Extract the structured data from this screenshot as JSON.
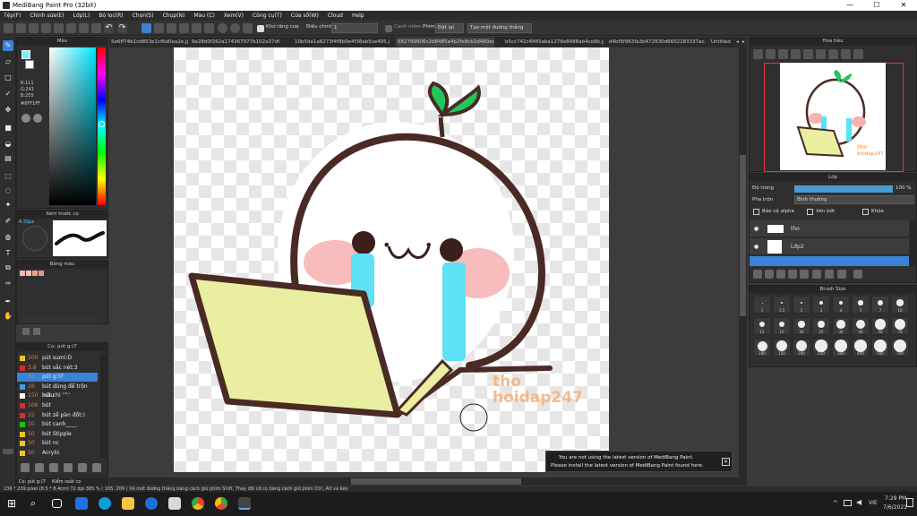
{
  "window": {
    "title": "MediBang Paint Pro (32bit)",
    "minimize": "—",
    "maximize": "☐",
    "close": "✕"
  },
  "menu": [
    "Tệp(F)",
    "Chỉnh sửa(E)",
    "Lớp(L)",
    "Bộ lọc(R)",
    "Chọn(S)",
    "Chụp(N)",
    "Màu (C)",
    "Xem(V)",
    "Công cụ(T)",
    "Cửa sổ(W)",
    "Cloud",
    "Help"
  ],
  "toolbar": {
    "antialias": "Khử răng cưa",
    "correction_label": "Điều chỉnh",
    "correction_value": "1",
    "edge_snap": "Canh mềm",
    "snap_label": "Phím",
    "snap_off": "Đặt lại",
    "create_snap": "Tạo một đường thẳng"
  },
  "doc_tabs": [
    "5e6ff74b1cd853e1cf6d0ea2e.jpg",
    "9e28d0f262a174367977b102a37d642ef.jpg",
    "10b5da1a6273f4f8b9e4f38ab5ce495.jpg",
    "582799906c2d8485a4b2fe8cb2d489ed.jpg",
    "b5cc742c4865aba1278e8488ab4ce8b.jpg",
    "d4bf5f963fa3b472830d6602183337ac.jpg",
    "Untitled"
  ],
  "color_panel": {
    "title": "Màu",
    "r": "R:111",
    "g": "G:241",
    "b": "B:255",
    "hex": "#6FF1FF"
  },
  "preview_panel": {
    "title": "Xem trước cọ",
    "size": "4.32px"
  },
  "palette_panel": {
    "title": "Bảng màu",
    "swatches": [
      "#f4b8a8",
      "#f6c0b0",
      "#f0a090"
    ]
  },
  "brush_panel": {
    "title": "Cọ: pút g:)7",
    "brushes": [
      {
        "size": "100",
        "name": "pút sumi:D",
        "color": "#e8c820"
      },
      {
        "size": "3.8",
        "name": "bút sắc nét:3",
        "color": "#d03030"
      },
      {
        "size": "33",
        "name": "pút g:)7",
        "color": "#2a8ae0"
      },
      {
        "size": "26",
        "name": "bút dùng để trộn màu",
        "color": "#3aa0e0"
      },
      {
        "size": "150",
        "name": "bút chì '^'",
        "color": "#ffffff"
      },
      {
        "size": "106",
        "name": "bút",
        "color": "#d03030"
      },
      {
        "size": "15",
        "name": "bút zế pàn đốt:)",
        "color": "#d03030"
      },
      {
        "size": "10",
        "name": "bút canh____",
        "color": "#20c020"
      },
      {
        "size": "50",
        "name": "bút Stipple",
        "color": "#e8c820"
      },
      {
        "size": "50",
        "name": "bút nc",
        "color": "#e8c820"
      },
      {
        "size": "50",
        "name": "Acrylic",
        "color": "#e8c820"
      }
    ],
    "bottom_tabs": [
      "Cọ: pút g:)7",
      "Kiểm soát cọ"
    ]
  },
  "navigator": {
    "title": "Hoa tiêu"
  },
  "layer_panel": {
    "title": "Lớp",
    "opacity_label": "Độ trong",
    "opacity_value": "100 %",
    "opacity_fraction": 1.0,
    "blend_label": "Pha trộn",
    "blend_value": "Bình thường",
    "protect_alpha": "Bảo vệ alpha",
    "clipping": "Xén bớt",
    "lock": "Khóa",
    "layers": [
      {
        "name": "tho"
      },
      {
        "name": "Lớp2"
      }
    ]
  },
  "brush_size_panel": {
    "title": "Brush Size",
    "row1": [
      "1",
      "1.5",
      "2",
      "3",
      "4",
      "5",
      "7",
      "10"
    ],
    "row2": [
      "12",
      "15",
      "20",
      "25",
      "30",
      "40",
      "50",
      "70"
    ],
    "row3": [
      "100",
      "150",
      "200",
      "250",
      "300",
      "400",
      "500",
      "700"
    ]
  },
  "canvas": {
    "watermark_line1": "tho",
    "watermark_line2": "hoidap247"
  },
  "notification": {
    "line1": "You are not using the latest version of MediBang Paint.",
    "line2": "Please install the latest version of MediBang Paint found here."
  },
  "statusbar": "236 * 239 pixel  (8.5 * 8.4cm)  72 dpi  385 %  ( 165, 209 )  Vẽ một đường thẳng bằng cách giữ phím Shift, Thay đổi cỡ cọ bằng cách giữ phím Ctrl, Alt và kéo",
  "taskbar": {
    "lang": "VIE",
    "time": "7:29 PM",
    "date": "7/6/2021"
  }
}
